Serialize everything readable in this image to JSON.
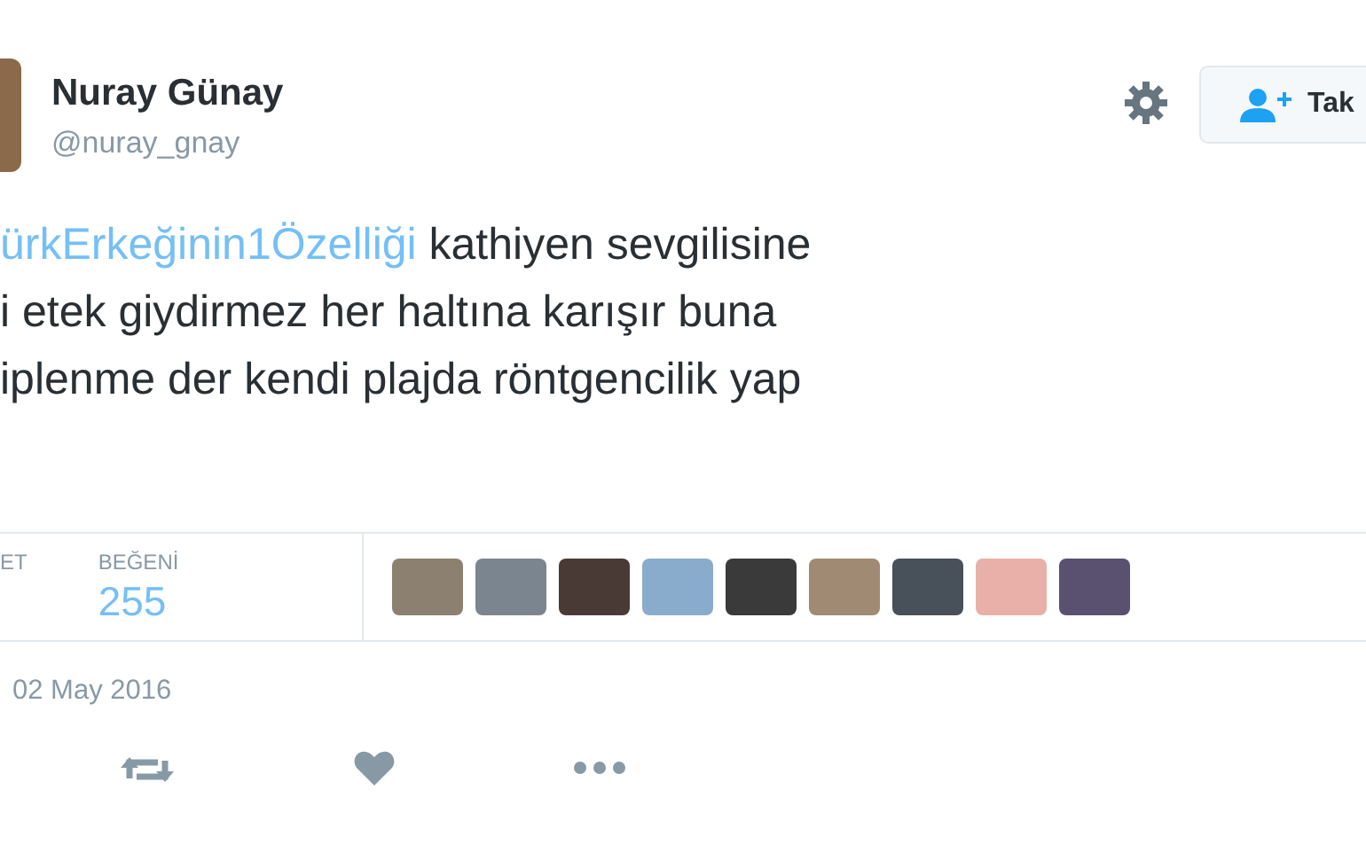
{
  "author": {
    "name": "Nuray Günay",
    "handle": "@nuray_gnay"
  },
  "follow_button": {
    "label": "Tak"
  },
  "tweet_lines": [
    {
      "hashtag": "ürkErkeğinin1Özelliği",
      "text": "kathiyen sevgilisine"
    },
    {
      "text": "i etek giydirmez her haltına karışır buna"
    },
    {
      "text": "iplenme der kendi plajda röntgencilik yap"
    }
  ],
  "stats": [
    {
      "label": "ET"
    },
    {
      "label": "BEĞENİ",
      "value": "255"
    }
  ],
  "liker_avatars": [
    {
      "kind": "photo"
    },
    {
      "kind": "photo"
    },
    {
      "kind": "photo"
    },
    {
      "kind": "photo"
    },
    {
      "kind": "photo"
    },
    {
      "kind": "photo"
    },
    {
      "kind": "photo"
    },
    {
      "kind": "photo"
    },
    {
      "kind": "photo"
    }
  ],
  "date": "02 May 2016",
  "actions": [
    {
      "kind": "retweet"
    },
    {
      "kind": "like"
    },
    {
      "kind": "more"
    }
  ]
}
